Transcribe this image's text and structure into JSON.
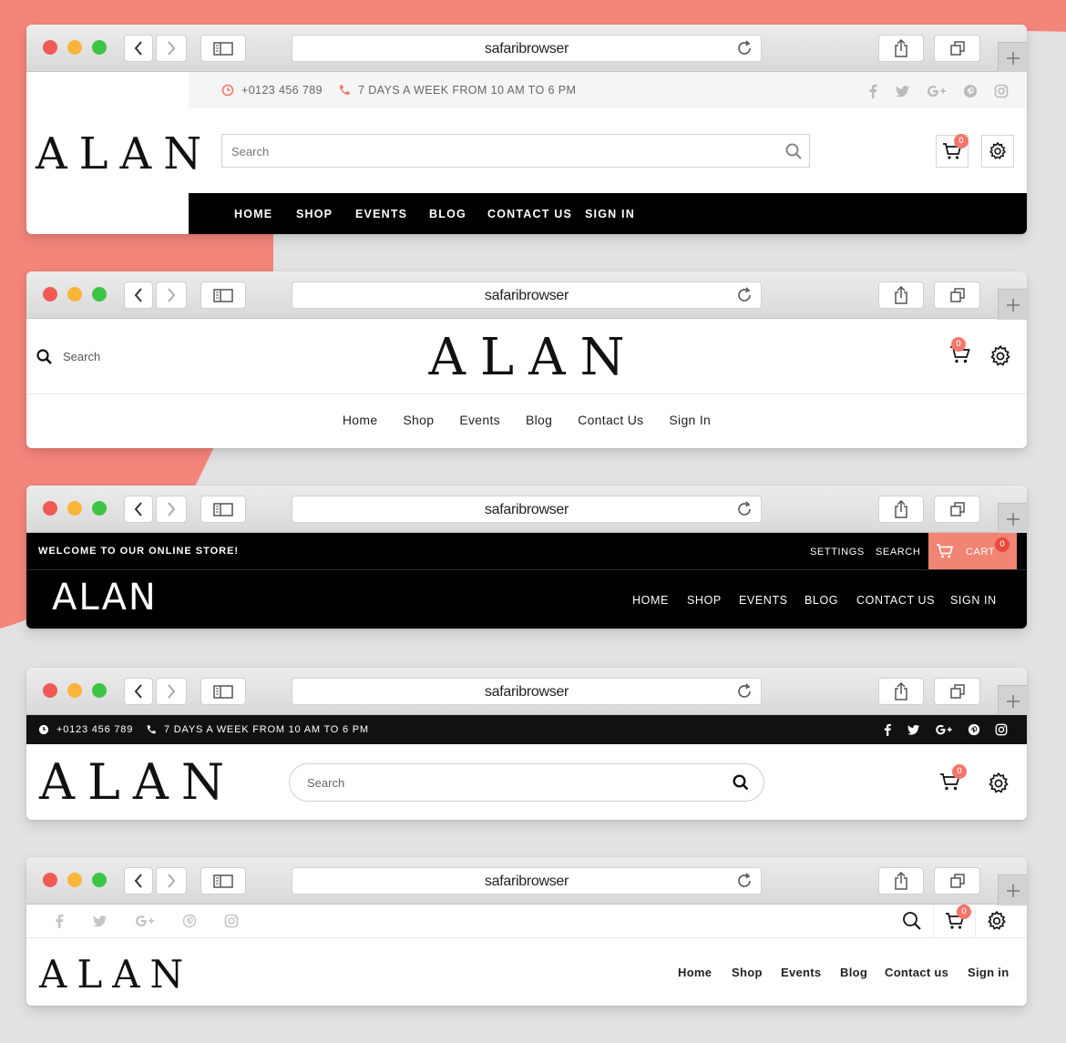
{
  "browser": {
    "url": "safaribrowser",
    "icons": [
      "close-dot",
      "minimize-dot",
      "zoom-dot",
      "back-icon",
      "forward-icon",
      "sidebar-icon",
      "reload-icon",
      "share-icon",
      "tabs-icon",
      "new-tab-icon"
    ]
  },
  "colors": {
    "accent": "#f2776b",
    "background_shape": "#f4857b",
    "dark_bar": "#000000"
  },
  "header1": {
    "phone": "+0123 456 789",
    "hours": "7 DAYS A WEEK FROM 10 AM TO 6 PM",
    "social": [
      "facebook",
      "twitter",
      "google-plus",
      "pinterest",
      "instagram"
    ],
    "logo": "ALAN",
    "search_placeholder": "Search",
    "cart_count": "0",
    "nav": [
      "HOME",
      "SHOP",
      "EVENTS",
      "BLOG",
      "CONTACT US",
      "SIGN IN"
    ]
  },
  "header2": {
    "search_label": "Search",
    "logo": "ALAN",
    "cart_count": "0",
    "nav": [
      "Home",
      "Shop",
      "Events",
      "Blog",
      "Contact Us",
      "Sign In"
    ]
  },
  "header3": {
    "welcome": "WELCOME TO OUR ONLINE STORE!",
    "settings": "SETTINGS",
    "search": "SEARCH",
    "cart": "CART",
    "cart_count": "0",
    "logo": "ALAN",
    "nav": [
      "HOME",
      "SHOP",
      "EVENTS",
      "BLOG",
      "CONTACT US",
      "SIGN IN"
    ]
  },
  "header4": {
    "phone": "+0123 456 789",
    "hours": "7 DAYS A WEEK FROM 10 AM TO 6 PM",
    "social": [
      "facebook",
      "twitter",
      "google-plus",
      "pinterest",
      "instagram"
    ],
    "logo": "ALAN",
    "search_placeholder": "Search",
    "cart_count": "0"
  },
  "header5": {
    "social": [
      "facebook",
      "twitter",
      "google-plus",
      "pinterest",
      "instagram"
    ],
    "cart_count": "0",
    "logo": "ALAN",
    "nav": [
      "Home",
      "Shop",
      "Events",
      "Blog",
      "Contact us",
      "Sign in"
    ]
  }
}
